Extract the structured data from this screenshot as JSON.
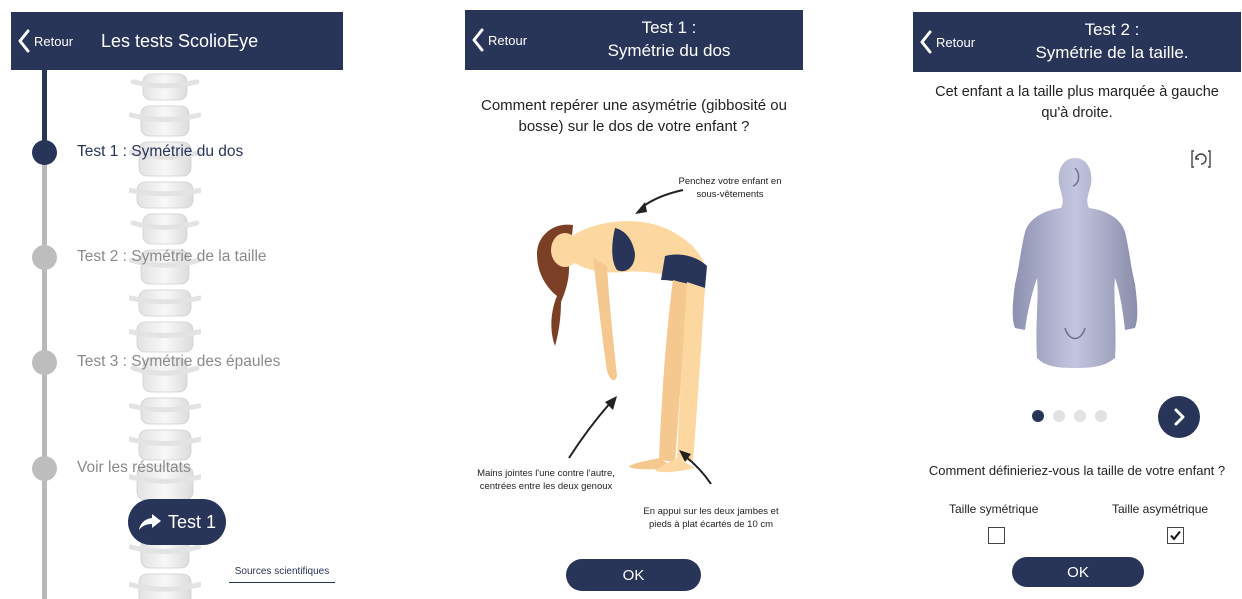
{
  "colors": {
    "primary": "#283559",
    "inactive": "#bdbdbd",
    "skin": "#fcd8a0",
    "clothing": "#283559",
    "hair": "#7a3f24"
  },
  "screen1": {
    "header": {
      "back_label": "Retour",
      "title": "Les tests ScolioEye"
    },
    "timeline": [
      {
        "label": "Test 1 : Symétrie du dos",
        "state": "active"
      },
      {
        "label": "Test 2 : Symétrie de la taille",
        "state": "inactive"
      },
      {
        "label": "Test 3 : Symétrie des épaules",
        "state": "inactive"
      },
      {
        "label": "Voir les résultats",
        "state": "inactive"
      }
    ],
    "start_button": {
      "label": "Test 1",
      "icon": "share-arrow-icon"
    },
    "sources_link": "Sources scientifiques"
  },
  "screen2": {
    "header": {
      "back_label": "Retour",
      "title_line1": "Test 1 :",
      "title_line2": "Symétrie du dos"
    },
    "question": "Comment repérer une asymétrie (gibbosité ou bosse) sur le dos de votre enfant ?",
    "callouts": {
      "underwear": "Penchez votre enfant en sous-vêtements",
      "hands": "Mains jointes l'une contre l'autre, centrées entre les deux genoux",
      "feet": "En appui sur les deux jambes et pieds à plat écartés de 10 cm"
    },
    "ok_label": "OK"
  },
  "screen3": {
    "header": {
      "back_label": "Retour",
      "title_line1": "Test 2 :",
      "title_line2": "Symétrie de la taille."
    },
    "question": "Cet enfant a la taille plus marquée à gauche qu'à droite.",
    "carousel": {
      "total": 4,
      "active_index": 0
    },
    "question2": "Comment définieriez-vous la taille de votre enfant ?",
    "options": [
      {
        "label": "Taille symétrique",
        "checked": false
      },
      {
        "label": "Taille asymétrique",
        "checked": true
      }
    ],
    "ok_label": "OK"
  }
}
